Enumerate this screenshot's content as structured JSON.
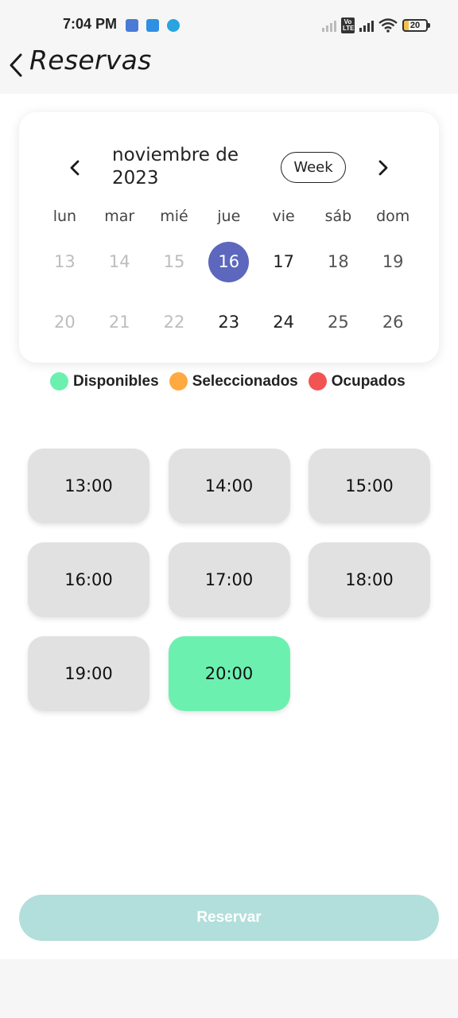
{
  "status_bar": {
    "time": "7:04 PM",
    "battery_level": "20",
    "notification_icons": [
      "calendar-icon",
      "b-app-icon",
      "telegram-icon"
    ],
    "system_icons": [
      "signal-icon",
      "volte-icon",
      "signal-icon",
      "wifi-icon",
      "battery-icon"
    ],
    "volte_label": "Vo LTE"
  },
  "header": {
    "title": "Reservas",
    "back_icon": "chevron-left-icon"
  },
  "calendar": {
    "month_label": "noviembre de 2023",
    "view_toggle": "Week",
    "weekdays": [
      "lun",
      "mar",
      "mié",
      "jue",
      "vie",
      "sáb",
      "dom"
    ],
    "weeks": [
      [
        {
          "day": "13",
          "state": "past"
        },
        {
          "day": "14",
          "state": "past"
        },
        {
          "day": "15",
          "state": "past"
        },
        {
          "day": "16",
          "state": "selected"
        },
        {
          "day": "17",
          "state": "active"
        },
        {
          "day": "18",
          "state": "weekend"
        },
        {
          "day": "19",
          "state": "weekend"
        }
      ],
      [
        {
          "day": "20",
          "state": "past"
        },
        {
          "day": "21",
          "state": "past"
        },
        {
          "day": "22",
          "state": "past"
        },
        {
          "day": "23",
          "state": "active"
        },
        {
          "day": "24",
          "state": "active"
        },
        {
          "day": "25",
          "state": "weekend"
        },
        {
          "day": "26",
          "state": "weekend"
        }
      ]
    ],
    "selected_color": "#5c67bd"
  },
  "legend": [
    {
      "label": "Disponibles",
      "color": "#6cf0b0"
    },
    {
      "label": "Seleccionados",
      "color": "#ffa940"
    },
    {
      "label": "Ocupados",
      "color": "#f25454"
    }
  ],
  "time_slots": [
    {
      "time": "13:00",
      "status": "default"
    },
    {
      "time": "14:00",
      "status": "default"
    },
    {
      "time": "15:00",
      "status": "default"
    },
    {
      "time": "16:00",
      "status": "default"
    },
    {
      "time": "17:00",
      "status": "default"
    },
    {
      "time": "18:00",
      "status": "default"
    },
    {
      "time": "19:00",
      "status": "default"
    },
    {
      "time": "20:00",
      "status": "available"
    }
  ],
  "reserve_button": {
    "label": "Reservar",
    "color": "#b2dfdb",
    "enabled": false
  }
}
